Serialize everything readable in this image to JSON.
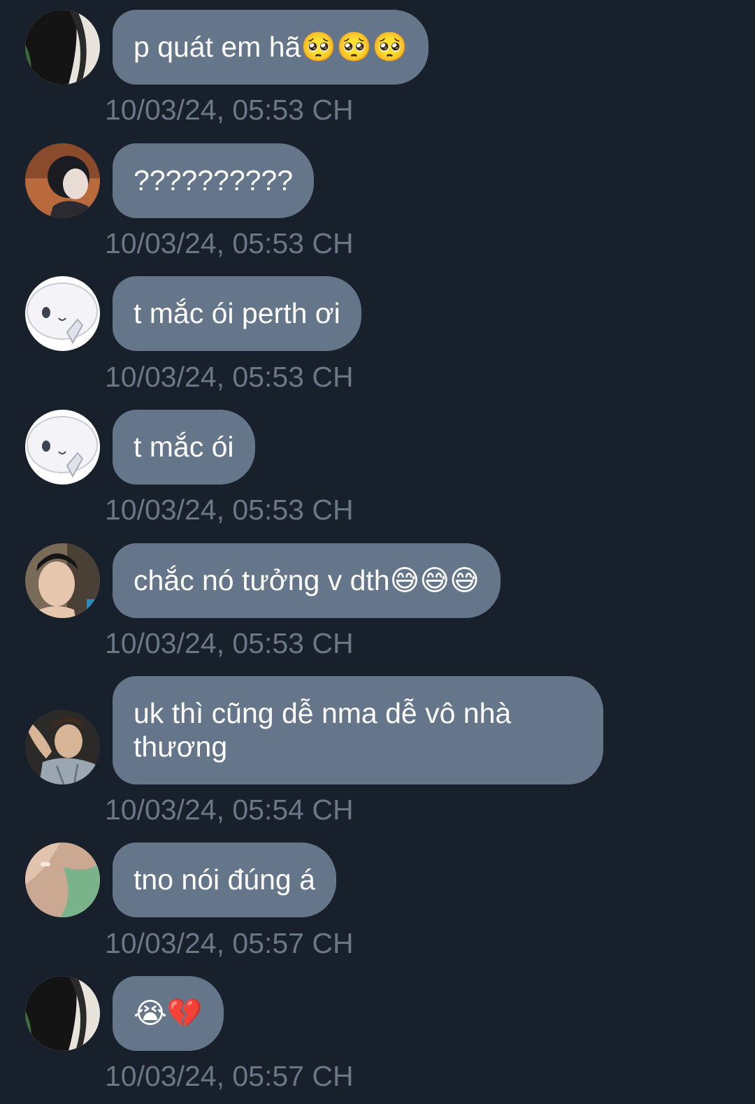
{
  "colors": {
    "background": "#17202b",
    "bubble": "#66768a",
    "message_text": "#ffffff",
    "timestamp_text": "#6a7785"
  },
  "messages": [
    {
      "avatar": "avatar-dark-photo-icon",
      "text": "p quát em hã🥺🥺🥺",
      "time": "10/03/24, 05:53 CH"
    },
    {
      "avatar": "avatar-cartoon-girl-icon",
      "text": "??????????",
      "time": "10/03/24, 05:53 CH"
    },
    {
      "avatar": "avatar-white-mascot-icon",
      "text": "t mắc ói perth ơi",
      "time": "10/03/24, 05:53 CH"
    },
    {
      "avatar": "avatar-white-mascot-icon",
      "text": "t mắc ói",
      "time": "10/03/24, 05:53 CH"
    },
    {
      "avatar": "avatar-selfie-boy-icon",
      "text": "chắc nó tưởng v dth😅😅😅",
      "time": "10/03/24, 05:53 CH"
    },
    {
      "avatar": "avatar-boy-jacket-icon",
      "text": "uk thì cũng dễ nma dễ vô nhà thương",
      "time": "10/03/24, 05:54 CH"
    },
    {
      "avatar": "avatar-green-shirt-icon",
      "text": "tno nói đúng á",
      "time": "10/03/24, 05:57 CH"
    },
    {
      "avatar": "avatar-dark-photo-icon",
      "text": "😭💔",
      "time": "10/03/24, 05:57 CH"
    }
  ]
}
